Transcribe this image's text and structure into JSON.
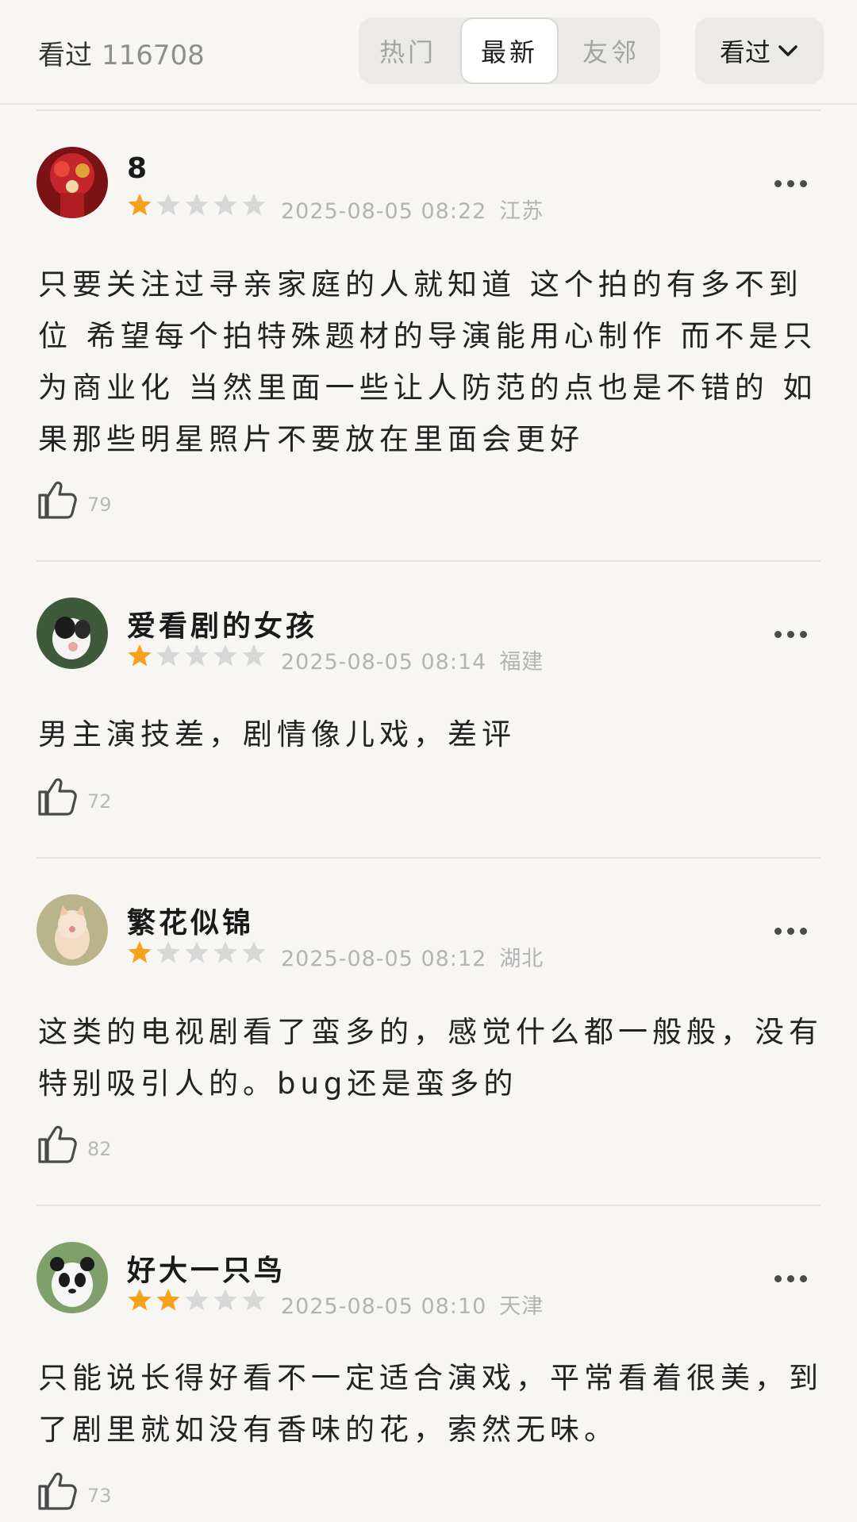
{
  "header": {
    "seen_label": "看过",
    "seen_count": "116708",
    "tabs": [
      {
        "label": "热门",
        "active": false
      },
      {
        "label": "最新",
        "active": true
      },
      {
        "label": "友邻",
        "active": false
      }
    ],
    "filter_label": "看过"
  },
  "colors": {
    "star_on": "#f4a21d",
    "star_off": "#d7d7d7"
  },
  "comments": [
    {
      "user": "8",
      "rating": 1,
      "datetime": "2025-08-05 08:22",
      "region": "江苏",
      "text": "只要关注过寻亲家庭的人就知道 这个拍的有多不到位 希望每个拍特殊题材的导演能用心制作 而不是只为商业化 当然里面一些让人防范的点也是不错的  如果那些明星照片不要放在里面会更好",
      "likes": "79"
    },
    {
      "user": "爱看剧的女孩",
      "rating": 1,
      "datetime": "2025-08-05 08:14",
      "region": "福建",
      "text": "男主演技差，剧情像儿戏，差评",
      "likes": "72"
    },
    {
      "user": "繁花似锦",
      "rating": 1,
      "datetime": "2025-08-05 08:12",
      "region": "湖北",
      "text": "这类的电视剧看了蛮多的，感觉什么都一般般，没有特别吸引人的。bug还是蛮多的",
      "likes": "82"
    },
    {
      "user": "好大一只鸟",
      "rating": 2,
      "datetime": "2025-08-05 08:10",
      "region": "天津",
      "text": "只能说长得好看不一定适合演戏，平常看着很美，到了剧里就如没有香味的花，索然无味。",
      "likes": "73"
    }
  ]
}
